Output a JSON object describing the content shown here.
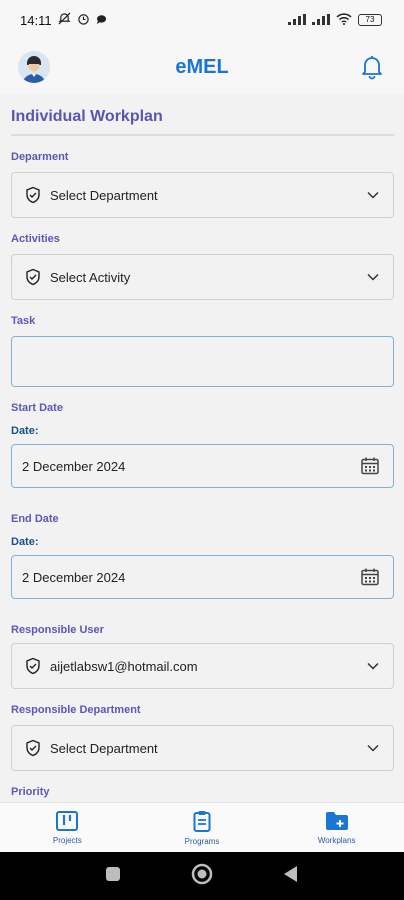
{
  "status_bar": {
    "time": "14:11",
    "battery": "73"
  },
  "header": {
    "title": "eMEL"
  },
  "page": {
    "title": "Individual Workplan"
  },
  "form": {
    "department": {
      "label": "Deparment",
      "value": "Select Department"
    },
    "activities": {
      "label": "Activities",
      "value": "Select Activity"
    },
    "task": {
      "label": "Task",
      "value": ""
    },
    "start_date": {
      "label": "Start Date",
      "sublabel": "Date:",
      "value": "2 December 2024"
    },
    "end_date": {
      "label": "End Date",
      "sublabel": "Date:",
      "value": "2 December 2024"
    },
    "responsible_user": {
      "label": "Responsible User",
      "value": "aijetlabsw1@hotmail.com"
    },
    "responsible_department": {
      "label": "Responsible Department",
      "value": "Select Department"
    },
    "priority": {
      "label": "Priority"
    }
  },
  "bottom_nav": {
    "items": [
      {
        "label": "Projects",
        "icon": "board-icon"
      },
      {
        "label": "Programs",
        "icon": "clipboard-icon"
      },
      {
        "label": "Workplans",
        "icon": "folder-add-icon"
      }
    ]
  },
  "colors": {
    "accent": "#1976d2",
    "label": "#5c57b8",
    "title": "#5a55b3",
    "focus_border": "#7fb3d6"
  }
}
